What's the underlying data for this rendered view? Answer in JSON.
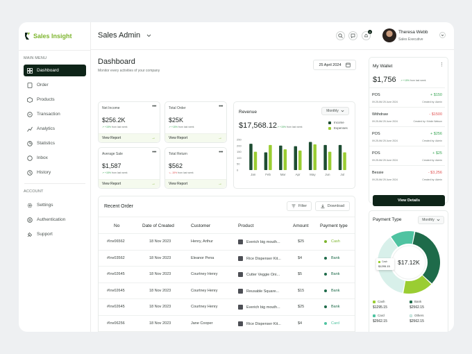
{
  "brand": {
    "name": "Sales Insight"
  },
  "sidebar": {
    "main_menu_label": "MAIN MENU",
    "account_label": "ACCOUNT",
    "main_items": [
      {
        "label": "Dashboard",
        "icon": "grid-icon"
      },
      {
        "label": "Order",
        "icon": "order-icon"
      },
      {
        "label": "Products",
        "icon": "products-icon"
      },
      {
        "label": "Transaction",
        "icon": "transaction-icon"
      },
      {
        "label": "Analytics",
        "icon": "analytics-icon"
      },
      {
        "label": "Statistics",
        "icon": "statistics-icon"
      },
      {
        "label": "Inbox",
        "icon": "inbox-icon"
      },
      {
        "label": "History",
        "icon": "history-icon"
      }
    ],
    "account_items": [
      {
        "label": "Settings",
        "icon": "gear-icon"
      },
      {
        "label": "Authentication",
        "icon": "shield-icon"
      },
      {
        "label": "Support",
        "icon": "support-icon"
      }
    ]
  },
  "topbar": {
    "title": "Sales Admin",
    "notification_count": "2",
    "user_name": "Theresa Webb",
    "user_role": "Sales Executive"
  },
  "dashboard": {
    "title": "Dashboard",
    "subtitle": "Monitor every activities of your company",
    "date": "25 April 2024"
  },
  "stats": [
    {
      "label": "Net Income",
      "value": "$256.2K",
      "change": "+15%",
      "change_text": "from last week",
      "link": "View Report"
    },
    {
      "label": "Total Order",
      "value": "$25K",
      "change": "+15%",
      "change_text": "from last week",
      "link": "View Report"
    },
    {
      "label": "Average Sale",
      "value": "$1,587",
      "change": "+15%",
      "change_text": "from last week",
      "link": "View Report"
    },
    {
      "label": "Total Return",
      "value": "$562",
      "change": "-15%",
      "change_text": "from last week",
      "link": "View Report"
    }
  ],
  "revenue": {
    "title": "Revenue",
    "period": "Monthly",
    "value": "$17,568.12",
    "change": "+15%",
    "change_text": "from last week",
    "legend_income": "Income",
    "legend_expenses": "Expenses"
  },
  "chart_data": {
    "type": "bar",
    "categories": [
      "Jan",
      "Feb",
      "Mar",
      "Apr",
      "May",
      "Jun",
      "Jul"
    ],
    "series": [
      {
        "name": "Income",
        "values": [
          215,
          145,
          200,
          195,
          230,
          205,
          205
        ],
        "color": "#1e4d32"
      },
      {
        "name": "Expenses",
        "values": [
          150,
          205,
          170,
          160,
          210,
          150,
          145
        ],
        "color": "#9acd32"
      }
    ],
    "y_ticks": [
      "250",
      "200",
      "150",
      "100",
      "50",
      "0"
    ],
    "ylim": [
      0,
      250
    ],
    "grid": false
  },
  "orders": {
    "title": "Recent Order",
    "filter_label": "Filter",
    "download_label": "Download",
    "columns": [
      "No",
      "Date of Created",
      "Customer",
      "Product",
      "Amount",
      "Payment type"
    ],
    "rows": [
      {
        "no": "#Inv06562",
        "date": "18 Nov 2023",
        "customer": "Henry, Arthur",
        "product": "Everich big mouth...",
        "amount": "$25",
        "payment": "Cash",
        "pcolor": "#7db52e"
      },
      {
        "no": "#Inv03562",
        "date": "18 Nov 2023",
        "customer": "Eleanor Pena",
        "product": "Rice Dispenser Kit...",
        "amount": "$4",
        "payment": "Bank",
        "pcolor": "#1e6b4a"
      },
      {
        "no": "#Inv02645",
        "date": "18 Nov 2023",
        "customer": "Courtney Henry",
        "product": "Cutter Veggie Oni...",
        "amount": "$5",
        "payment": "Bank",
        "pcolor": "#1e6b4a"
      },
      {
        "no": "#Inv02645",
        "date": "18 Nov 2023",
        "customer": "Courtney Henry",
        "product": "Reusable Square...",
        "amount": "$15",
        "payment": "Bank",
        "pcolor": "#1e6b4a"
      },
      {
        "no": "#Inv02645",
        "date": "18 Nov 2023",
        "customer": "Courtney Henry",
        "product": "Everich big mouth...",
        "amount": "$25",
        "payment": "Bank",
        "pcolor": "#1e6b4a"
      },
      {
        "no": "#Inv06256",
        "date": "18 Nov 2023",
        "customer": "Jane Cooper",
        "product": "Rice Dispenser Kit...",
        "amount": "$4",
        "payment": "Card",
        "pcolor": "#4fc3a1"
      },
      {
        "no": "#Inv06256",
        "date": "18 Nov 2023",
        "customer": "Jane Cooper",
        "product": "New Backpack",
        "amount": "$21",
        "payment": "Cash",
        "pcolor": "#7db52e"
      }
    ]
  },
  "wallet": {
    "title": "My Wallet",
    "value": "$1,756",
    "change": "+15%",
    "change_text": "from last week",
    "details_label": "View Details",
    "transactions": [
      {
        "name": "POS",
        "amount": "+ $150",
        "date": "09.25 AM 25 June 2024",
        "creator": "Created by: Admin",
        "color": "#3aa655"
      },
      {
        "name": "Withdraw",
        "amount": "- $1500",
        "date": "09.25 AM 25 June 2024",
        "creator": "Created by: Kristin Watson",
        "color": "#e05252"
      },
      {
        "name": "POS",
        "amount": "+ $256",
        "date": "09.25 AM 25 June 2024",
        "creator": "Created by: Admin",
        "color": "#3aa655"
      },
      {
        "name": "POS",
        "amount": "+ $25",
        "date": "09.25 AM 25 June 2024",
        "creator": "Created by: Admin",
        "color": "#3aa655"
      },
      {
        "name": "Bessie",
        "amount": "- $3,256",
        "date": "09.25 AM 25 June 2024",
        "creator": "Created by: Admin",
        "color": "#e05252"
      }
    ]
  },
  "payment": {
    "title": "Payment Type",
    "period": "Monthly",
    "center_value": "$17.12K",
    "tooltip_label": "Cash",
    "tooltip_value": "$1295.15",
    "legend": [
      {
        "label": "Cash",
        "value": "$1295.15",
        "color": "#9acd32"
      },
      {
        "label": "Bank",
        "value": "$2562.15",
        "color": "#1e6b4a"
      },
      {
        "label": "Card",
        "value": "$2562.15",
        "color": "#4fc3a1"
      },
      {
        "label": "Others",
        "value": "$2562.15",
        "color": "#d8f0ea"
      }
    ],
    "shares": [
      0.16,
      0.34,
      0.13,
      0.37
    ]
  }
}
